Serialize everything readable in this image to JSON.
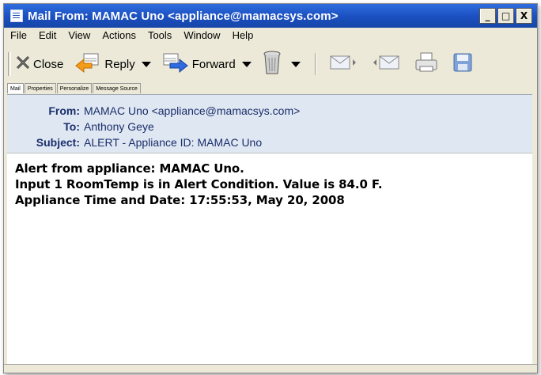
{
  "window": {
    "title": "Mail From: MAMAC Uno <appliance@mamacsys.com>",
    "controls": {
      "minimize": "_",
      "maximize": "□",
      "close": "X"
    }
  },
  "menu": [
    "File",
    "Edit",
    "View",
    "Actions",
    "Tools",
    "Window",
    "Help"
  ],
  "toolbar": {
    "close_label": "Close",
    "reply_label": "Reply",
    "forward_label": "Forward",
    "icons": [
      "close-x-icon",
      "reply-arrow-icon",
      "forward-arrow-icon",
      "trash-can-icon",
      "previous-message-icon",
      "next-message-icon",
      "print-icon",
      "save-disk-icon"
    ]
  },
  "tabs": [
    "Mail",
    "Properties",
    "Personalize",
    "Message Source"
  ],
  "header": {
    "from_label": "From:",
    "from_value": "MAMAC Uno <appliance@mamacsys.com>",
    "to_label": "To:",
    "to_value": "Anthony Geye",
    "subject_label": "Subject:",
    "subject_value": "ALERT - Appliance ID: MAMAC Uno"
  },
  "body": {
    "lines": [
      "Alert from appliance: MAMAC Uno.",
      "Input 1 RoomTemp is in Alert Condition. Value is 84.0 F.",
      "Appliance Time and Date: 17:55:53, May 20, 2008"
    ]
  },
  "colors": {
    "titlebar": "#1b4fbf",
    "header_bg": "#dfe7f2",
    "header_text": "#1a2e6a",
    "chrome": "#ece9d8"
  }
}
